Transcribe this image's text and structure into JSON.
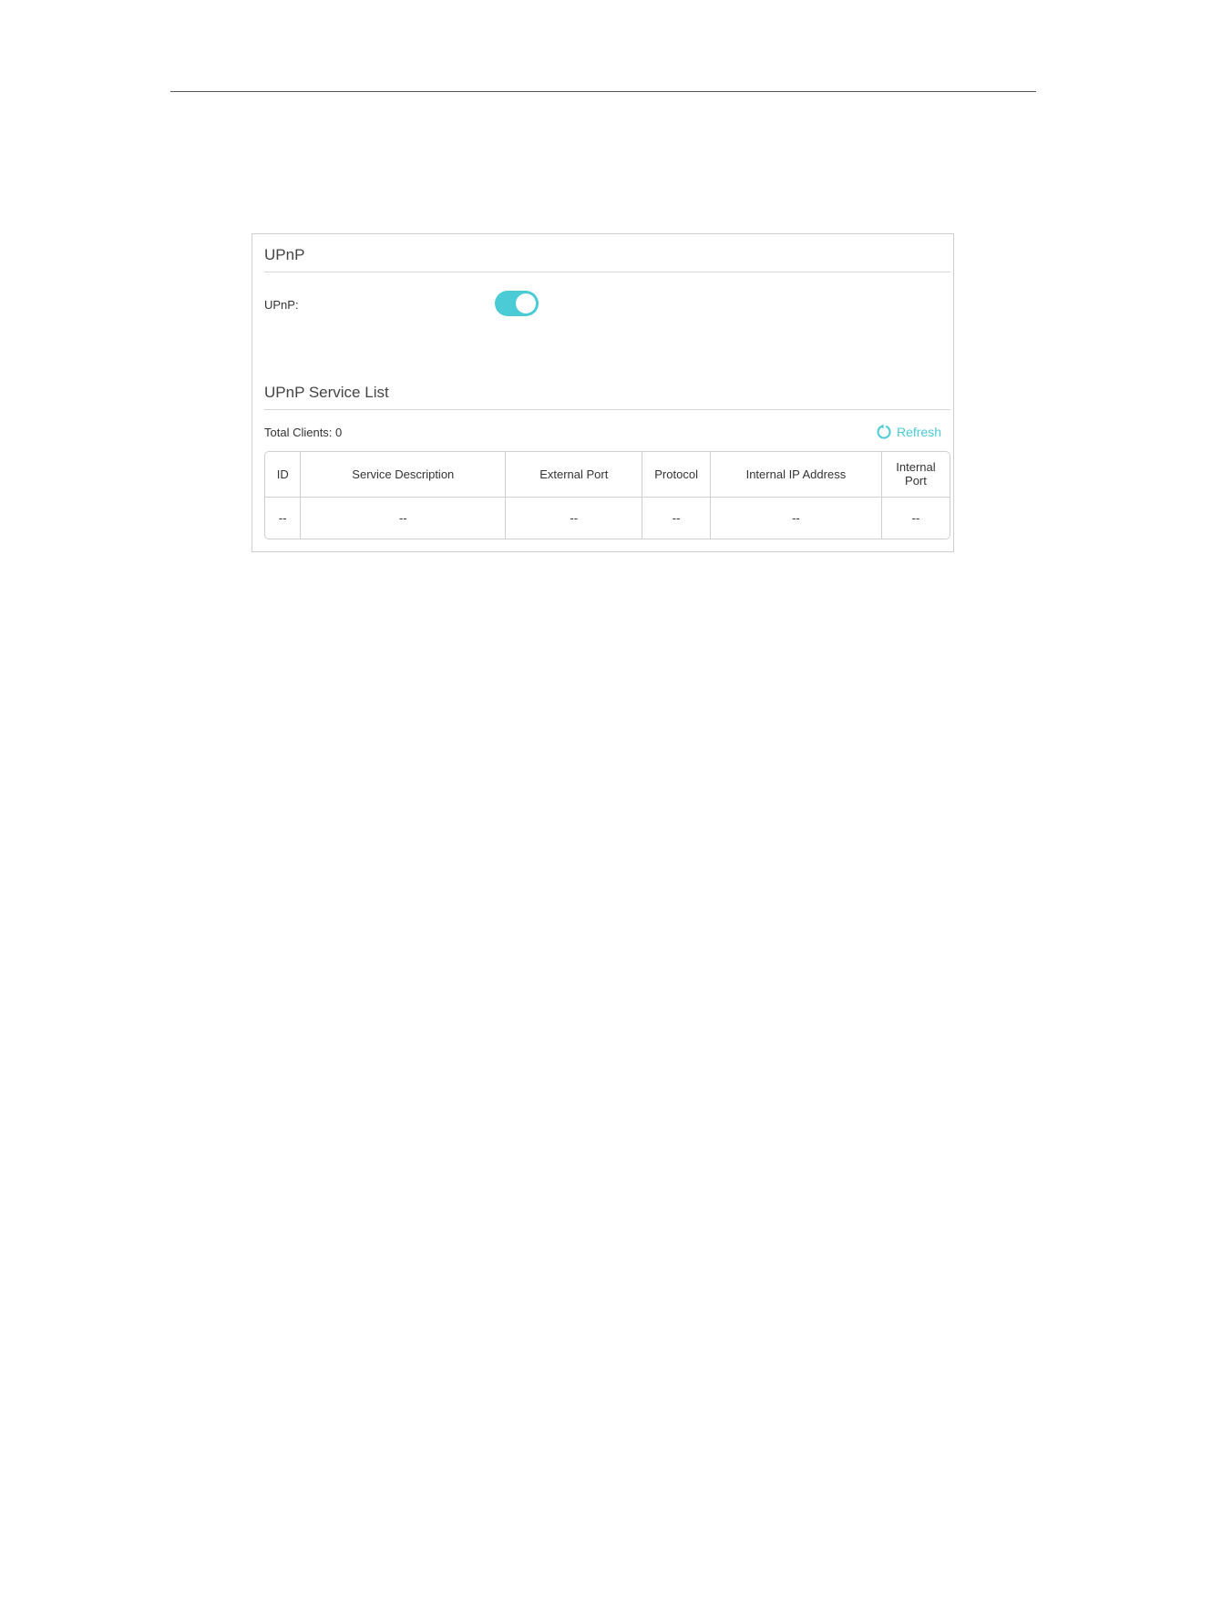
{
  "upnp_section": {
    "title": "UPnP",
    "label": "UPnP:",
    "enabled": true,
    "toggle_color": "#4acbd6"
  },
  "service_list": {
    "title": "UPnP Service List",
    "total_clients": "Total Clients: 0",
    "refresh_label": "Refresh",
    "refresh_icon": "refresh-icon",
    "columns": [
      "ID",
      "Service Description",
      "External Port",
      "Protocol",
      "Internal IP Address",
      "Internal Port"
    ],
    "rows": [
      [
        "--",
        "--",
        "--",
        "--",
        "--",
        "--"
      ]
    ]
  }
}
